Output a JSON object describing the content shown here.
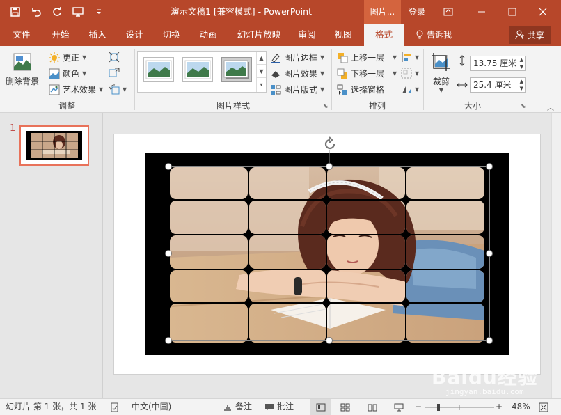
{
  "window": {
    "title": "演示文稿1 [兼容模式] - PowerPoint",
    "context_tab": "图片...",
    "login": "登录"
  },
  "tabs": [
    {
      "label": "文件"
    },
    {
      "label": "开始"
    },
    {
      "label": "插入"
    },
    {
      "label": "设计"
    },
    {
      "label": "切换"
    },
    {
      "label": "动画"
    },
    {
      "label": "幻灯片放映"
    },
    {
      "label": "审阅"
    },
    {
      "label": "视图"
    },
    {
      "label": "格式"
    }
  ],
  "tell_me": "告诉我",
  "share": "共享",
  "ribbon": {
    "adjust": {
      "label": "调整",
      "remove_bg": "删除背景",
      "corrections": "更正",
      "color": "颜色",
      "artistic": "艺术效果"
    },
    "styles": {
      "label": "图片样式",
      "border": "图片边框",
      "effects": "图片效果",
      "layout": "图片版式"
    },
    "arrange": {
      "label": "排列",
      "bring_forward": "上移一层",
      "send_backward": "下移一层",
      "selection_pane": "选择窗格"
    },
    "size": {
      "label": "大小",
      "crop": "裁剪",
      "height": "13.75 厘米",
      "width": "25.4 厘米"
    }
  },
  "thumbnails": {
    "slide_number": "1"
  },
  "status": {
    "slide_info": "幻灯片 第 1 张，共 1 张",
    "language": "中文(中国)",
    "notes": "备注",
    "comments": "批注",
    "zoom": "48%"
  },
  "watermark": {
    "text": "Baidu经验",
    "url": "jingyan.baidu.com"
  },
  "colors": {
    "accent": "#b7472a",
    "ribbon_bg": "#f3f3f3"
  }
}
